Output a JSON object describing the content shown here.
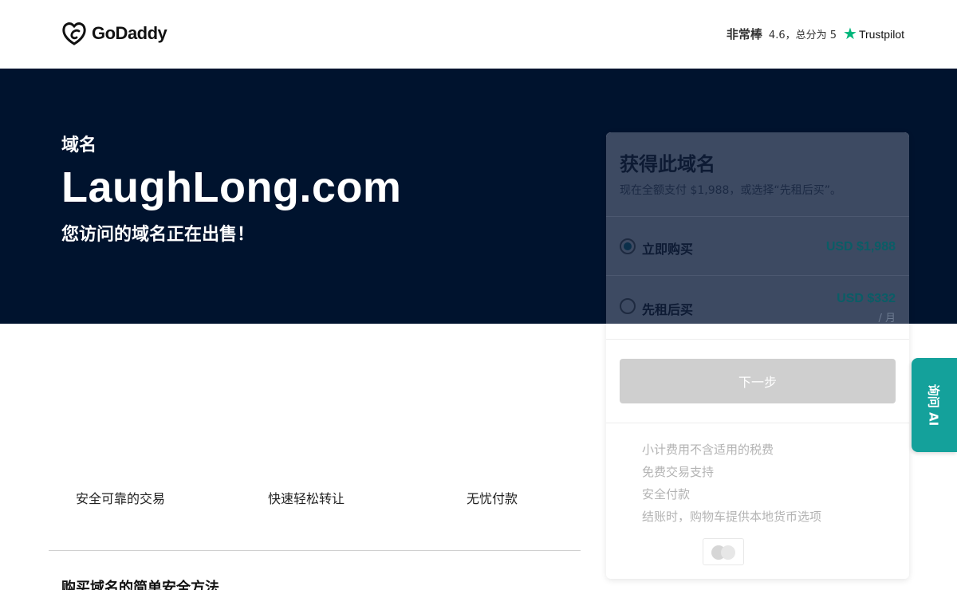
{
  "header": {
    "logo_text": "GoDaddy",
    "rating_word": "非常棒",
    "rating_text": "4.6，总分为 5",
    "trustpilot_label": "Trustpilot"
  },
  "hero": {
    "eyebrow": "域名",
    "domain": "LaughLong.com",
    "subtitle": "您访问的域名正在出售！"
  },
  "features": [
    "安全可靠的交易",
    "快速轻松转让",
    "无忧付款"
  ],
  "section_title": "购买域名的简单安全方法",
  "card": {
    "title": "获得此域名",
    "description": "现在全额支付 $1,988，或选择“先租后买”。",
    "options": [
      {
        "label": "立即购买",
        "price": "USD $1,988",
        "unit": "",
        "selected": true
      },
      {
        "label": "先租后买",
        "price": "USD $332",
        "unit": "/ 月",
        "selected": false
      }
    ],
    "next_label": "下一步",
    "notes": [
      "小计费用不含适用的税费",
      "免费交易支持",
      "安全付款",
      "结账时，购物车提供本地货币选项"
    ]
  },
  "side_tab": {
    "label": "询问 AI"
  },
  "colors": {
    "hero_bg": "#00132e",
    "card_head": "#3d4a62",
    "price": "#0a5d66",
    "side_tab": "#14a19b",
    "trustpilot_star": "#00b67a"
  },
  "icons": [
    "godaddy-logo-icon",
    "trustpilot-star-icon",
    "payment-card-icon"
  ]
}
